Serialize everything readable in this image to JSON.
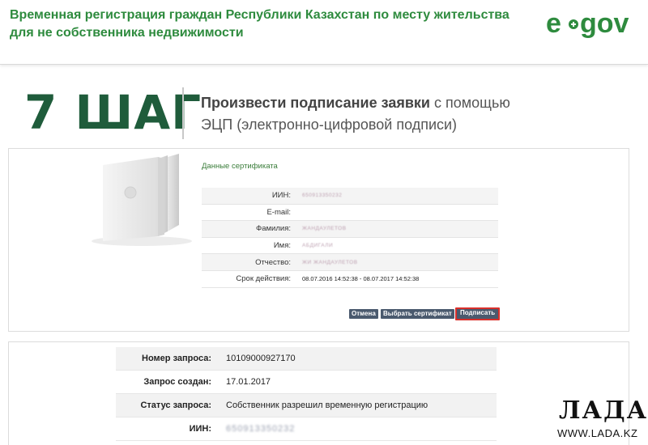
{
  "header": {
    "title": "Временная регистрация граждан Республики Казахстан по месту жительства для не собственника недвижимости",
    "logo_text": "e gov"
  },
  "step": {
    "number": "7 ШАГ",
    "desc_bold": "Произвести подписание заявки",
    "desc_rest": " с помощью ЭЦП (электронно-цифровой подписи)"
  },
  "certificate": {
    "title": "Данные сертификата",
    "rows": [
      {
        "label": "ИИН:",
        "value": "650913350232"
      },
      {
        "label": "E-mail:",
        "value": ""
      },
      {
        "label": "Фамилия:",
        "value": "ЖАНДАУЛЕТОВ"
      },
      {
        "label": "Имя:",
        "value": "АБДИГАЛИ"
      },
      {
        "label": "Отчество:",
        "value": "ЖИ ЖАНДАУЛЕТОВ"
      },
      {
        "label": "Срок действия:",
        "value": "08.07.2016 14:52:38 - 08.07.2017 14:52:38"
      }
    ],
    "buttons": {
      "cancel": "Отмена",
      "choose": "Выбрать сертификат",
      "sign": "Подписать"
    }
  },
  "request": {
    "rows": [
      {
        "label": "Номер запроса:",
        "value": "10109000927170"
      },
      {
        "label": "Запрос создан:",
        "value": "17.01.2017"
      },
      {
        "label": "Статус запроса:",
        "value": "Собственник разрешил временную регистрацию"
      },
      {
        "label": "ИИН:",
        "value": "650913350232"
      }
    ]
  },
  "watermark": {
    "main": "ЛАДА",
    "sub": "WWW.LADA.KZ"
  },
  "colors": {
    "brand_green": "#2e8b3e",
    "step_green": "#1f5c3b",
    "button": "#4a5a6e",
    "highlight": "#d9302b"
  }
}
